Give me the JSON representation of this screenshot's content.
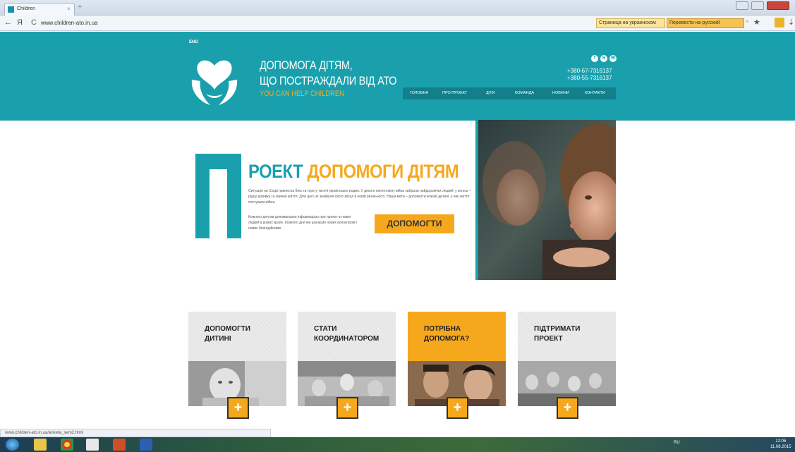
{
  "browser": {
    "tab_title": "Children",
    "tab_close": "×",
    "new_tab": "+",
    "back": "←",
    "yandex": "Я",
    "reload": "C",
    "url": "www.children-ato.in.ua",
    "translate_page": "Страница на украинском",
    "translate_to": "Перевести на русский",
    "translate_close": "×",
    "star": "★",
    "download": "⇣"
  },
  "header": {
    "lang": "ENG",
    "brand_line1": "ДОПОМОГА ДІТЯМ,",
    "brand_line2": "ЩО ПОСТРАЖДАЛИ ВІД АТО",
    "brand_tagline": "YOU CAN HELP CHILDREN",
    "social": [
      "f",
      "S",
      "✉"
    ],
    "phone1": "+380-67-7316137",
    "phone2": "+380-55-7316137",
    "nav": [
      "ГОЛОВНА",
      "ПРО ПРОЕКТ",
      "ДІТИ",
      "КОМАНДА",
      "НОВИНИ",
      "КОНТАКТИ"
    ]
  },
  "hero": {
    "title_a": "РОЕКТ",
    "title_b": "ДОПОМОГИ ДІТЯМ",
    "text1": "Ситуація на Сході принесла біль та горе у тисячі українських родин. У дехого неототожну війна забрала найдорожчих людей, у когось – рідну домівку та звичне життя. Діти досі не знайшли свого місця в новій реальності. Наша мета – допомогти кожній дитині, у чиє життя постукала війна.",
    "text2": "Кожного дня ми допомагаємо інформацією про проект в нових людей в різних краях. Кожного дня ми шукаємо нових волонтерів і нових благодійників.",
    "button": "ДОПОМОГТИ"
  },
  "cards": [
    {
      "line1": "ДОПОМОГТИ",
      "line2": "ДИТИНІ",
      "plus": "+"
    },
    {
      "line1": "СТАТИ",
      "line2": "КООРДИНАТОРОМ",
      "plus": "+"
    },
    {
      "line1": "ПОТРІБНА",
      "line2": "ДОПОМОГА?",
      "plus": "+"
    },
    {
      "line1": "ПІДТРИМАТИ",
      "line2": "ПРОЕКТ",
      "plus": "+"
    }
  ],
  "status_url": "www.children-ato.in.ua/anketa_sem2.html",
  "taskbar": {
    "tray": "RU",
    "time": "12:06",
    "date": "11.08.2015"
  },
  "colors": {
    "teal": "#1aa0ad",
    "orange": "#f6a81c"
  }
}
